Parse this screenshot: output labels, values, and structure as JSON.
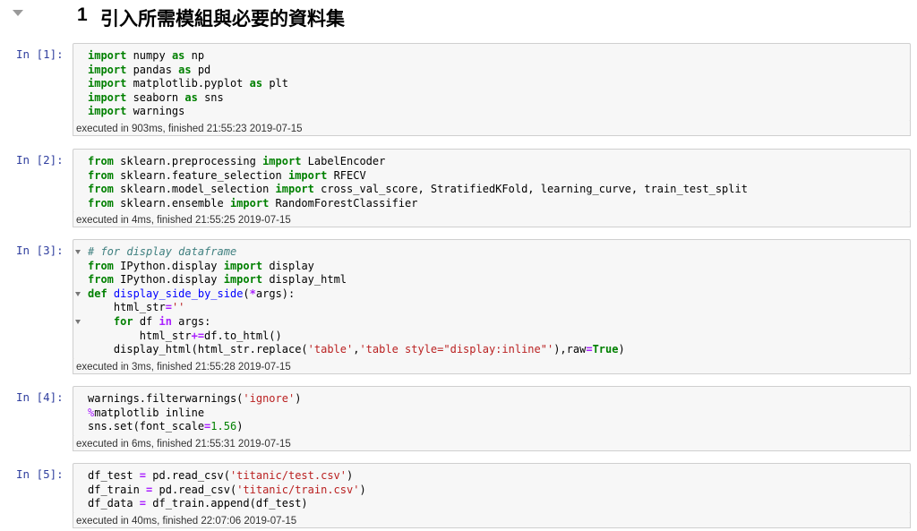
{
  "heading": {
    "number": "1",
    "title": "引入所需模組與必要的資料集"
  },
  "cells": [
    {
      "prompt": "In [1]:",
      "exec_info": "executed in 903ms, finished 21:55:23 2019-07-15"
    },
    {
      "prompt": "In [2]:",
      "exec_info": "executed in 4ms, finished 21:55:25 2019-07-15"
    },
    {
      "prompt": "In [3]:",
      "exec_info": "executed in 3ms, finished 21:55:28 2019-07-15"
    },
    {
      "prompt": "In [4]:",
      "exec_info": "executed in 6ms, finished 21:55:31 2019-07-15"
    },
    {
      "prompt": "In [5]:",
      "exec_info": "executed in 40ms, finished 22:07:06 2019-07-15"
    }
  ],
  "code": {
    "c1": [
      [
        [
          "import",
          "kw"
        ],
        [
          " numpy ",
          ""
        ],
        [
          "as",
          "kw"
        ],
        [
          " np",
          ""
        ]
      ],
      [
        [
          "import",
          "kw"
        ],
        [
          " pandas ",
          ""
        ],
        [
          "as",
          "kw"
        ],
        [
          " pd",
          ""
        ]
      ],
      [
        [
          "import",
          "kw"
        ],
        [
          " matplotlib.pyplot ",
          ""
        ],
        [
          "as",
          "kw"
        ],
        [
          " plt",
          ""
        ]
      ],
      [
        [
          "import",
          "kw"
        ],
        [
          " seaborn ",
          ""
        ],
        [
          "as",
          "kw"
        ],
        [
          " sns",
          ""
        ]
      ],
      [
        [
          "import",
          "kw"
        ],
        [
          " warnings",
          ""
        ]
      ]
    ],
    "c2": [
      [
        [
          "from",
          "kw"
        ],
        [
          " sklearn.preprocessing ",
          ""
        ],
        [
          "import",
          "kw"
        ],
        [
          " LabelEncoder",
          ""
        ]
      ],
      [
        [
          "from",
          "kw"
        ],
        [
          " sklearn.feature_selection ",
          ""
        ],
        [
          "import",
          "kw"
        ],
        [
          " RFECV",
          ""
        ]
      ],
      [
        [
          "from",
          "kw"
        ],
        [
          " sklearn.model_selection ",
          ""
        ],
        [
          "import",
          "kw"
        ],
        [
          " cross_val_score, StratifiedKFold, learning_curve, train_test_split",
          ""
        ]
      ],
      [
        [
          "from",
          "kw"
        ],
        [
          " sklearn.ensemble ",
          ""
        ],
        [
          "import",
          "kw"
        ],
        [
          " RandomForestClassifier",
          ""
        ]
      ]
    ],
    "c3": [
      [
        [
          "# for display dataframe",
          "cm"
        ]
      ],
      [
        [
          "from",
          "kw"
        ],
        [
          " IPython.display ",
          ""
        ],
        [
          "import",
          "kw"
        ],
        [
          " display",
          ""
        ]
      ],
      [
        [
          "from",
          "kw"
        ],
        [
          " IPython.display ",
          ""
        ],
        [
          "import",
          "kw"
        ],
        [
          " display_html",
          ""
        ]
      ],
      [
        [
          "def",
          "kw"
        ],
        [
          " ",
          ""
        ],
        [
          "display_side_by_side",
          "fn"
        ],
        [
          "(",
          ""
        ],
        [
          "*",
          "op"
        ],
        [
          "args):",
          ""
        ]
      ],
      [
        [
          "    html_str",
          ""
        ],
        [
          "=",
          "op"
        ],
        [
          "''",
          "str"
        ]
      ],
      [
        [
          "    ",
          ""
        ],
        [
          "for",
          "kw"
        ],
        [
          " df ",
          ""
        ],
        [
          "in",
          "op"
        ],
        [
          " args:",
          ""
        ]
      ],
      [
        [
          "        html_str",
          ""
        ],
        [
          "+=",
          "op"
        ],
        [
          "df.to_html()",
          ""
        ]
      ],
      [
        [
          "    display_html(html_str.replace(",
          ""
        ],
        [
          "'table'",
          "str"
        ],
        [
          ",",
          ""
        ],
        [
          "'table style=\"display:inline\"'",
          "str"
        ],
        [
          "),raw",
          ""
        ],
        [
          "=",
          "op"
        ],
        [
          "True",
          "kw"
        ],
        [
          ")",
          ""
        ]
      ]
    ],
    "c4": [
      [
        [
          "warnings.filterwarnings(",
          ""
        ],
        [
          "'ignore'",
          "str"
        ],
        [
          ")",
          ""
        ]
      ],
      [
        [
          "%",
          "mg"
        ],
        [
          "matplotlib inline",
          ""
        ]
      ],
      [
        [
          "sns.set(font_scale",
          ""
        ],
        [
          "=",
          "op"
        ],
        [
          "1.56",
          "num"
        ],
        [
          ")",
          ""
        ]
      ]
    ],
    "c5": [
      [
        [
          "df_test ",
          ""
        ],
        [
          "=",
          "op"
        ],
        [
          " pd.read_csv(",
          ""
        ],
        [
          "'titanic/test.csv'",
          "str"
        ],
        [
          ")",
          ""
        ]
      ],
      [
        [
          "df_train ",
          ""
        ],
        [
          "=",
          "op"
        ],
        [
          " pd.read_csv(",
          ""
        ],
        [
          "'titanic/train.csv'",
          "str"
        ],
        [
          ")",
          ""
        ]
      ],
      [
        [
          "df_data ",
          ""
        ],
        [
          "=",
          "op"
        ],
        [
          " df_train.append(df_test)",
          ""
        ]
      ]
    ]
  }
}
